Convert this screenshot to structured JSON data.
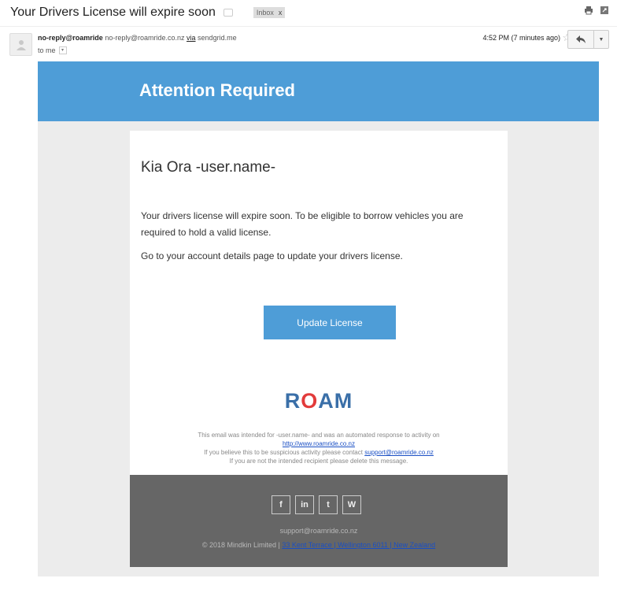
{
  "email": {
    "subject": "Your Drivers License will expire soon",
    "label": "Inbox",
    "label_close": "x",
    "sender_name": "no-reply@roamride",
    "sender_email": "no-reply@roamride.co.nz",
    "via_text": "via",
    "via_domain": "sendgrid.me",
    "to_text": "to me",
    "time": "4:52 PM (7 minutes ago)"
  },
  "body": {
    "banner_title": "Attention Required",
    "greeting": "Kia Ora -user.name-",
    "paragraph1": "Your drivers license will expire soon. To be eligible to borrow vehicles you are required to hold a valid license.",
    "paragraph2": "Go to your account details page to update your drivers license.",
    "cta_label": "Update License",
    "logo_text_pre": "R",
    "logo_text_o": "O",
    "logo_text_post": "AM",
    "fine_line1": "This email was intended for -user.name- and was an automated response to activity on",
    "fine_link1": "http://www.roamride.co.nz",
    "fine_line2_pre": "If you believe this to be suspicious activity please contact",
    "fine_link2": "support@roamride.co.nz",
    "fine_line3": "If you are not the intended recipient please delete this message."
  },
  "footer": {
    "socials": [
      "f",
      "in",
      "t",
      "W"
    ],
    "support_email": "support@roamride.co.nz",
    "copyright": "© 2018 Mindkin Limited |",
    "address": "33 Kent Terrace | Wellington 6011 | New Zealand"
  },
  "icons": {
    "print": "print-icon",
    "popout": "new-window-icon",
    "star": "star-icon",
    "reply": "reply-icon",
    "more": "more-options-icon",
    "avatar": "avatar-icon"
  },
  "colors": {
    "accent": "#4e9dd7",
    "footer_bg": "#666666",
    "logo_blue": "#3a6fa8",
    "logo_red": "#e23b3b"
  }
}
